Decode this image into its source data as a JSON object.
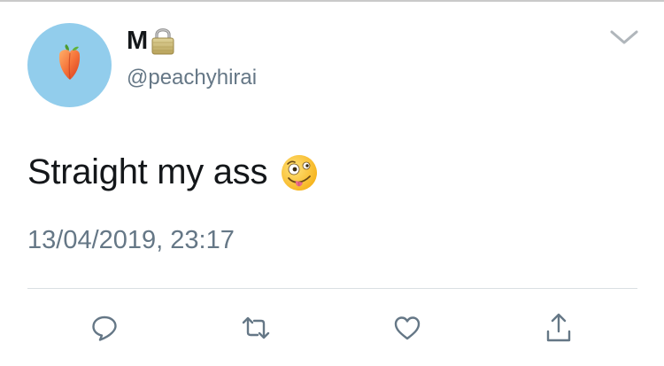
{
  "user": {
    "display_name": "M",
    "handle": "@peachyhirai",
    "avatar_bg": "#92cdec",
    "avatar_icon": "peach-icon",
    "badge_icon": "lock-icon"
  },
  "tweet": {
    "text": "Straight my ass",
    "emoji": "zany-face-emoji",
    "timestamp": "13/04/2019, 23:17"
  },
  "actions": [
    {
      "name": "reply",
      "icon": "reply-icon"
    },
    {
      "name": "retweet",
      "icon": "retweet-icon"
    },
    {
      "name": "like",
      "icon": "heart-icon"
    },
    {
      "name": "share",
      "icon": "share-icon"
    }
  ],
  "colors": {
    "text_primary": "#14171a",
    "text_secondary": "#657786",
    "icon_gray": "#657786",
    "divider": "#dadfe3"
  }
}
